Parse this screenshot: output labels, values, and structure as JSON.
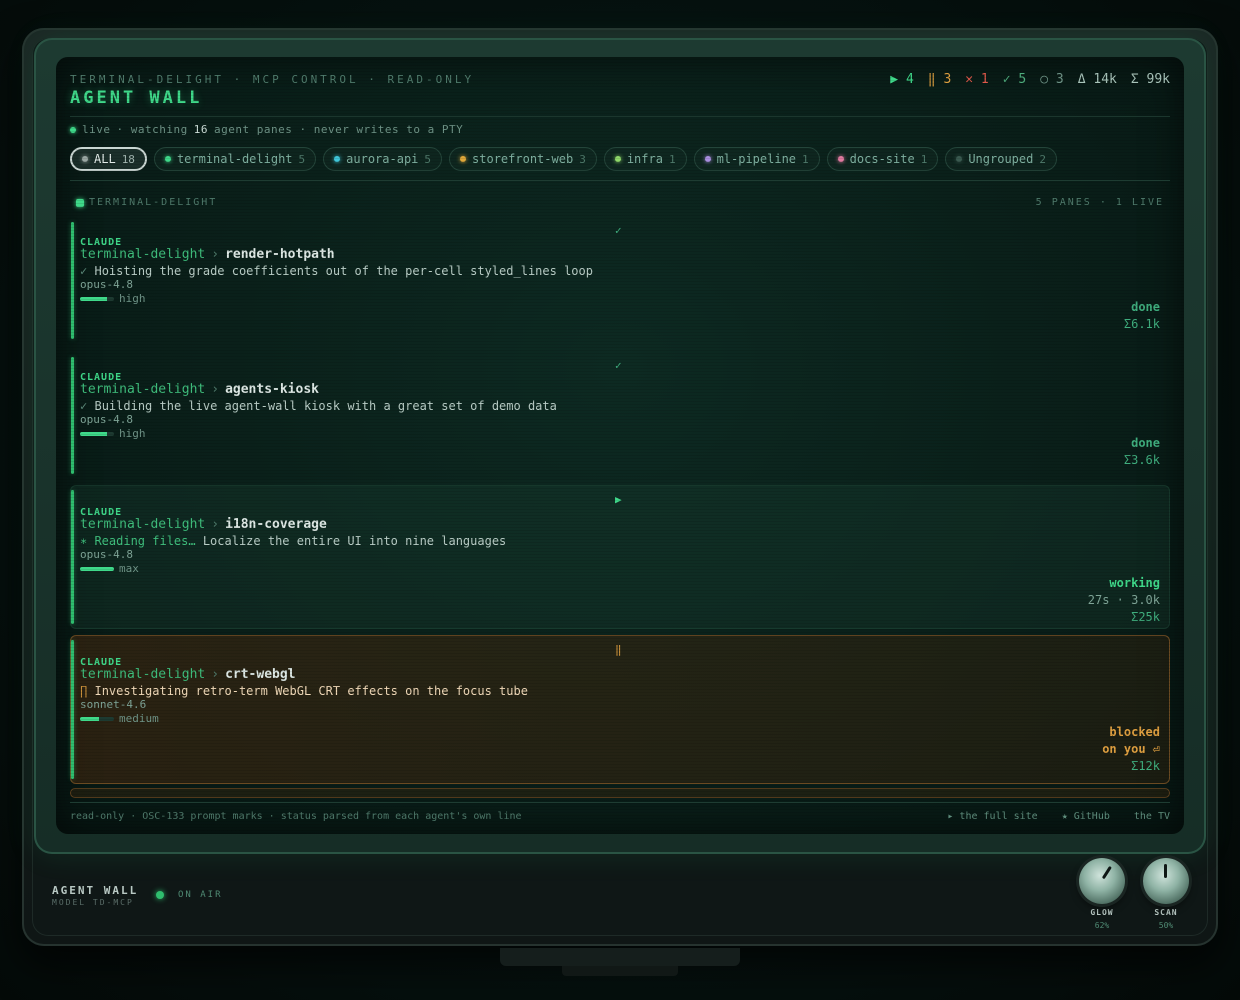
{
  "header": {
    "kicker": "TERMINAL-DELIGHT · MCP CONTROL · READ-ONLY",
    "title": "AGENT WALL",
    "stats": [
      {
        "icon": "▶",
        "value": "4",
        "color": "#3fd98a"
      },
      {
        "icon": "‖",
        "value": "3",
        "color": "#e0a040"
      },
      {
        "icon": "✕",
        "value": "1",
        "color": "#e0584a"
      },
      {
        "icon": "✓",
        "value": "5",
        "color": "#4fae7e"
      },
      {
        "icon": "○",
        "value": "3",
        "color": "#6f9487"
      },
      {
        "icon": "Δ",
        "value": "14k",
        "color": "#a9c4ba"
      },
      {
        "icon": "Σ",
        "value": "99k",
        "color": "#a9c4ba"
      }
    ]
  },
  "live": {
    "label": "live",
    "prefix": "· watching",
    "count": "16",
    "suffix": "agent panes · never writes to a PTY"
  },
  "chips": [
    {
      "label": "ALL",
      "count": "18",
      "color": "#9aa7a3",
      "active": true
    },
    {
      "label": "terminal-delight",
      "count": "5",
      "color": "#3fd98a"
    },
    {
      "label": "aurora-api",
      "count": "5",
      "color": "#3fc6d9"
    },
    {
      "label": "storefront-web",
      "count": "3",
      "color": "#e0a83a"
    },
    {
      "label": "infra",
      "count": "1",
      "color": "#8fd96a"
    },
    {
      "label": "ml-pipeline",
      "count": "1",
      "color": "#a98fe0"
    },
    {
      "label": "docs-site",
      "count": "1",
      "color": "#e07aa0"
    },
    {
      "label": "Ungrouped",
      "count": "2",
      "color": "#3a5a50"
    }
  ],
  "group": {
    "name": "TERMINAL-DELIGHT",
    "meta": "5 PANES · 1 LIVE"
  },
  "cards": [
    {
      "glyph": "✓",
      "agent": "CLAUDE",
      "project": "terminal-delight",
      "task": "render-hotpath",
      "desc_prefix": "✓",
      "desc": "Hoisting the grade coefficients out of the per-cell styled_lines loop",
      "model": "opus-4.8",
      "effort": "high",
      "effort_level": 0.8,
      "status": "done",
      "status2": "",
      "timing": "",
      "tokens": "Σ6.1k"
    },
    {
      "glyph": "✓",
      "agent": "CLAUDE",
      "project": "terminal-delight",
      "task": "agents-kiosk",
      "desc_prefix": "✓",
      "desc": "Building the live agent-wall kiosk with a great set of demo data",
      "model": "opus-4.8",
      "effort": "high",
      "effort_level": 0.8,
      "status": "done",
      "status2": "",
      "timing": "",
      "tokens": "Σ3.6k"
    },
    {
      "glyph": "▶",
      "agent": "CLAUDE",
      "project": "terminal-delight",
      "task": "i18n-coverage",
      "desc_prefix": "∗ Reading files…",
      "desc": "Localize the entire UI into nine languages",
      "model": "opus-4.8",
      "effort": "max",
      "effort_level": 1.0,
      "status": "working",
      "status2": "",
      "timing": "27s · 3.0k",
      "tokens": "Σ25k"
    },
    {
      "glyph": "‖",
      "agent": "CLAUDE",
      "project": "terminal-delight",
      "task": "crt-webgl",
      "desc_prefix": "∏",
      "desc": "Investigating retro-term WebGL CRT effects on the focus tube",
      "model": "sonnet-4.6",
      "effort": "medium",
      "effort_level": 0.55,
      "status": "blocked",
      "status2": "on you ⏎",
      "timing": "",
      "tokens": "Σ12k"
    }
  ],
  "footer": {
    "note": "read-only · OSC-133 prompt marks · status parsed from each agent's own line",
    "links": [
      "▸ the full site",
      "★ GitHub",
      "the TV"
    ]
  },
  "tv": {
    "brand": "AGENT WALL",
    "model_no": "MODEL TD-MCP",
    "onair": "ON AIR",
    "knobs": [
      {
        "label": "GLOW",
        "value": "62%",
        "level": 0.62
      },
      {
        "label": "SCAN",
        "value": "50%",
        "level": 0.5
      }
    ]
  }
}
